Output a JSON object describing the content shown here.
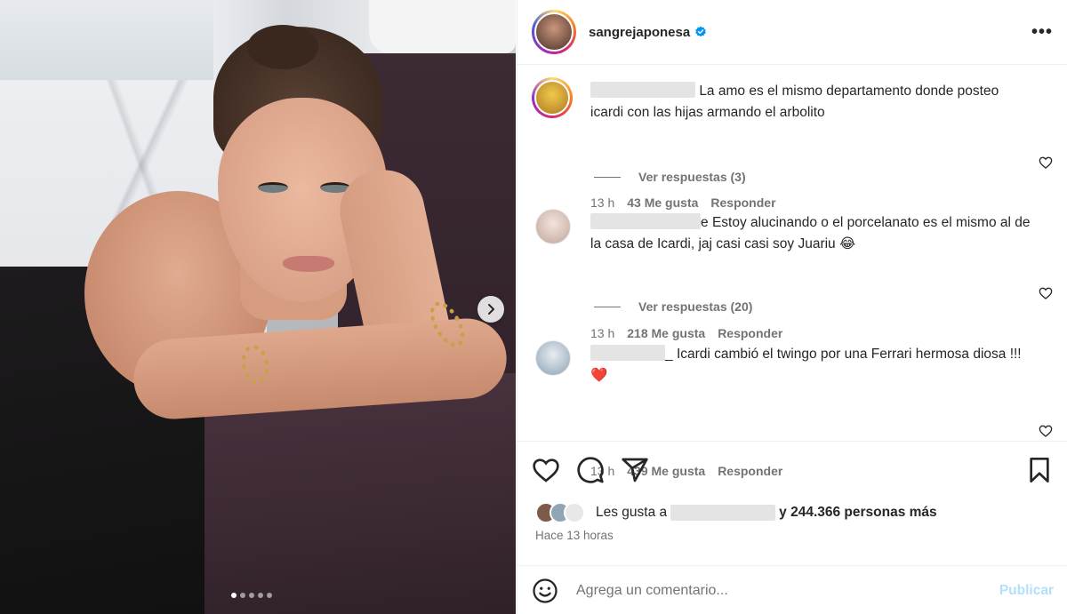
{
  "post": {
    "username": "sangrejaponesa",
    "more_label": "•••"
  },
  "comments": [
    {
      "text": "La amo es el mismo departamento donde posteo icardi con las hijas armando el arbolito",
      "time": "13 h",
      "likes": "43 Me gusta",
      "reply": "Responder",
      "view_replies": "Ver respuestas (3)"
    },
    {
      "text_prefix": "e",
      "text": "Estoy alucinando o el porcelanato es el mismo al de la casa de Icardi, jaj casi casi soy Juariu 😂",
      "time": "13 h",
      "likes": "218 Me gusta",
      "reply": "Responder",
      "view_replies": "Ver respuestas (20)"
    },
    {
      "text_prefix": "_",
      "text": "Icardi cambió el twingo por una Ferrari hermosa diosa !!!❤️",
      "time": "13 h",
      "likes": "439 Me gusta",
      "reply": "Responder"
    }
  ],
  "likes_summary": {
    "prefix": "Les gusta a",
    "suffix_bold": "y 244.366 personas más"
  },
  "timestamp": "Hace 13 horas",
  "composer": {
    "placeholder": "Agrega un comentario...",
    "publish_label": "Publicar"
  },
  "colors": {
    "link_blue_disabled": "#b2dffc",
    "verified_blue": "#0095f6",
    "heart_red": "#ed4956"
  },
  "icons": [
    "heart-icon",
    "comment-icon",
    "share-icon",
    "bookmark-icon",
    "emoji-icon",
    "verified-badge-icon",
    "chevron-right-icon",
    "more-icon"
  ]
}
